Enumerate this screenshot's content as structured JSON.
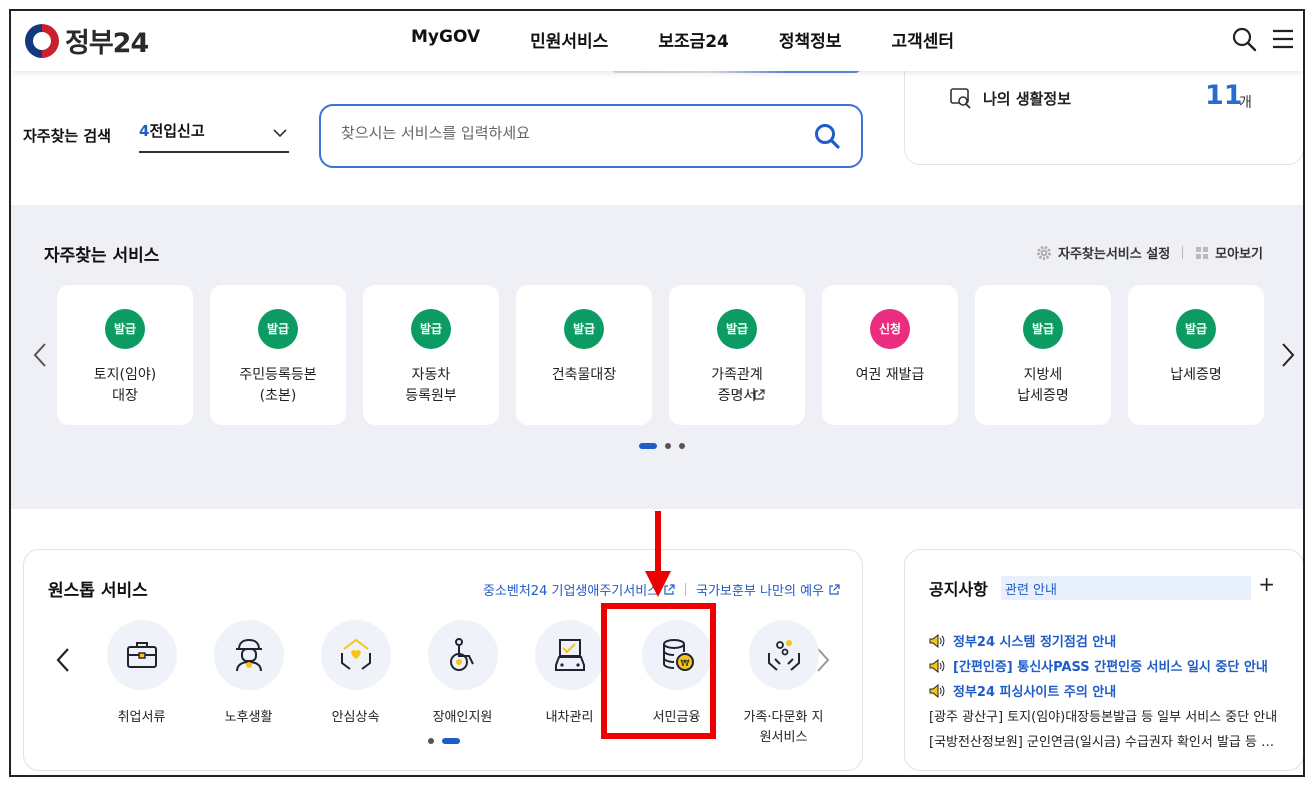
{
  "header": {
    "logo_text": "정부24",
    "nav": [
      "MyGOV",
      "민원서비스",
      "보조금24",
      "정책정보",
      "고객센터"
    ],
    "icons": [
      "search-icon",
      "menu-icon"
    ]
  },
  "search": {
    "label": "자주찾는 검색",
    "select_num": "4",
    "select_text": "전입신고",
    "placeholder": "찾으시는 서비스를 입력하세요"
  },
  "mylife": {
    "label": "나의 생활정보",
    "count": "11",
    "unit": "개"
  },
  "freq": {
    "title": "자주찾는 서비스",
    "link_settings": "자주찾는서비스 설정",
    "link_view": "모아보기",
    "cards": [
      {
        "badge": "발급",
        "name": "토지(임야)\n대장",
        "badge_color": "#0c9c63"
      },
      {
        "badge": "발급",
        "name": "주민등록등본\n(초본)",
        "badge_color": "#0c9c63"
      },
      {
        "badge": "발급",
        "name": "자동차\n등록원부",
        "badge_color": "#0c9c63"
      },
      {
        "badge": "발급",
        "name": "건축물대장",
        "badge_color": "#0c9c63"
      },
      {
        "badge": "발급",
        "name": "가족관계\n증명서",
        "badge_color": "#0c9c63"
      },
      {
        "badge": "신청",
        "name": "여권 재발급",
        "badge_color": "#ea2d7e"
      },
      {
        "badge": "발급",
        "name": "지방세\n납세증명",
        "badge_color": "#0c9c63"
      },
      {
        "badge": "발급",
        "name": "납세증명",
        "badge_color": "#0c9c63"
      }
    ]
  },
  "onestop": {
    "title": "원스톱 서비스",
    "link1": "중소벤처24 기업생애주기서비스",
    "link2": "국가보훈부 나만의 예우",
    "items": [
      {
        "label": "취업서류",
        "icon": "briefcase-icon"
      },
      {
        "label": "노후생활",
        "icon": "elderly-icon"
      },
      {
        "label": "안심상속",
        "icon": "inheritance-hands-icon"
      },
      {
        "label": "장애인지원",
        "icon": "wheelchair-icon"
      },
      {
        "label": "내차관리",
        "icon": "car-document-icon"
      },
      {
        "label": "서민금융",
        "icon": "coins-icon"
      },
      {
        "label": "가족·다문화 지\n원서비스",
        "icon": "family-hands-icon"
      }
    ]
  },
  "notice": {
    "title": "공지사항",
    "tag": "관련 안내",
    "plus": "+",
    "rows": [
      {
        "text": "정부24 시스템 정기점검 안내",
        "highlight": true
      },
      {
        "text": "[간편인증] 통신사PASS 간편인증 서비스 일시 중단 안내",
        "highlight": true
      },
      {
        "text": "정부24 피싱사이트 주의 안내",
        "highlight": true
      },
      {
        "text": "[광주 광산구] 토지(임야)대장등본발급 등 일부 서비스 중단 안내",
        "highlight": false
      },
      {
        "text": "[국방전산정보원] 군인연금(일시금) 수급권자 확인서 발급 등 일부 서비스 중단 안내",
        "highlight": false
      }
    ]
  },
  "colors": {
    "accent": "#1f5cc8",
    "issue_badge": "#0c9c63",
    "apply_badge": "#ea2d7e",
    "annotation": "#ee0000"
  }
}
